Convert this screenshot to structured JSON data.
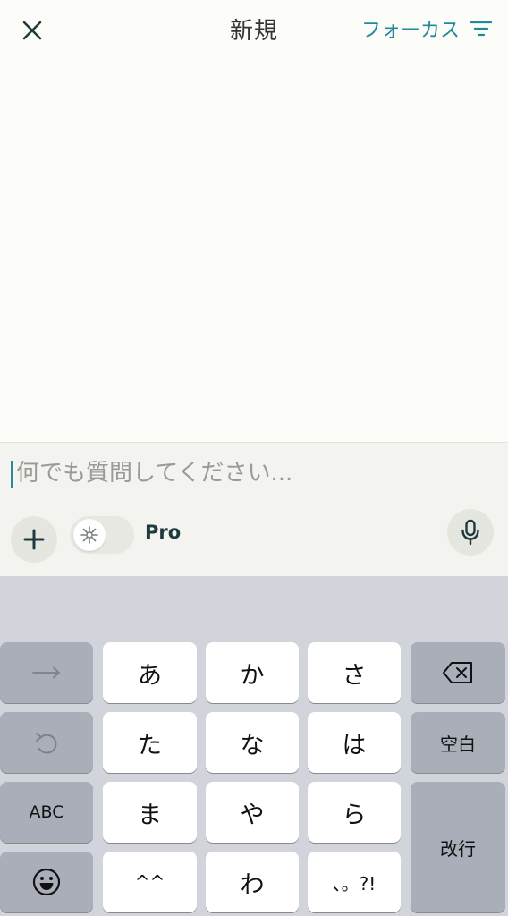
{
  "header": {
    "title": "新規",
    "focus_label": "フォーカス",
    "close_icon": "close-icon",
    "filter_icon": "filter-lines-icon"
  },
  "composer": {
    "placeholder": "何でも質問してください...",
    "value": "",
    "pro_label": "Pro",
    "pro_toggle_on": false,
    "plus_icon": "plus-icon",
    "sparkle_icon": "sparkle-icon",
    "mic_icon": "microphone-icon"
  },
  "keyboard": {
    "row1": [
      "あ",
      "か",
      "さ"
    ],
    "row2": [
      "た",
      "な",
      "は"
    ],
    "row3": [
      "ま",
      "や",
      "ら"
    ],
    "row4": [
      "^^",
      "わ",
      "、。?!"
    ],
    "space_label": "空白",
    "abc_label": "ABC",
    "return_label": "改行",
    "arrow_icon": "right-arrow-icon",
    "undo_icon": "undo-icon",
    "delete_icon": "backspace-icon",
    "emoji_icon": "emoji-icon"
  },
  "colors": {
    "accent": "#1f8a9a",
    "background": "#fcfcf8",
    "composer_bg": "#f3f3ef",
    "keyboard_bg": "#d1d4db"
  }
}
